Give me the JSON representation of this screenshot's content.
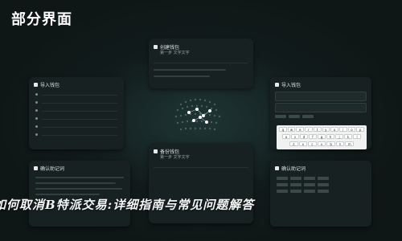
{
  "header": {
    "title": "部分界面"
  },
  "panels": {
    "top_center": {
      "title": "创建钱包",
      "subtitle": "第一步 文字文字"
    },
    "left_mid": {
      "title": "导入钱包"
    },
    "right_mid": {
      "title": "导入钱包"
    },
    "center_bot": {
      "title": "备份钱包",
      "subtitle": "第一步 文字文字"
    },
    "left_bot": {
      "title": "确认助记词"
    },
    "right_bot": {
      "title": "确认助记词"
    }
  },
  "keyboard": {
    "rows": [
      [
        "q",
        "w",
        "e",
        "r",
        "t",
        "y",
        "u",
        "i",
        "o",
        "p"
      ],
      [
        "a",
        "s",
        "d",
        "f",
        "g",
        "h",
        "j",
        "k",
        "l"
      ],
      [
        "z",
        "x",
        "c",
        "v",
        "b",
        "n",
        "m"
      ]
    ]
  },
  "watermark": {
    "text": "如何取消B特派交易:详细指南与常见问题解答"
  },
  "colors": {
    "background": "#0f1616",
    "panel": "#172121",
    "accent_text": "#ffffff"
  }
}
